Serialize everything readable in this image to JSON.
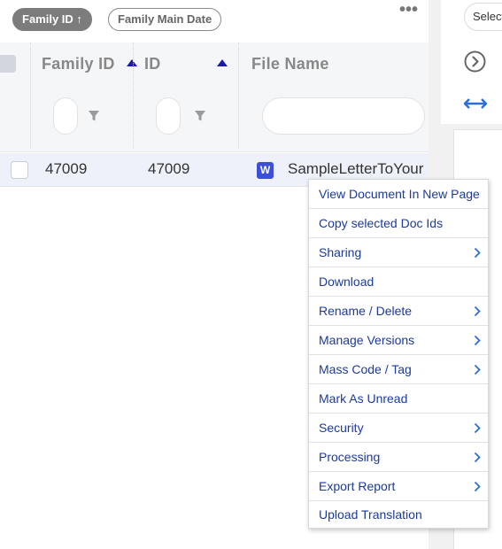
{
  "sort_chips": {
    "active_label": "Family ID",
    "active_arrow": "↑",
    "inactive_label": "Family Main Date"
  },
  "grid": {
    "more_label": "•••",
    "columns": [
      "Family ID",
      "ID",
      "File Name"
    ],
    "rows": [
      {
        "family_id": "47009",
        "id": "47009",
        "file_icon": "W",
        "file_name": "SampleLetterToYour"
      }
    ]
  },
  "right_panel": {
    "select_text": "Select"
  },
  "context_menu": {
    "items": [
      {
        "label": "View Document In New Page",
        "has_submenu": false
      },
      {
        "label": "Copy selected Doc Ids",
        "has_submenu": false
      },
      {
        "label": "Sharing",
        "has_submenu": true
      },
      {
        "label": "Download",
        "has_submenu": false
      },
      {
        "label": "Rename / Delete",
        "has_submenu": true
      },
      {
        "label": "Manage Versions",
        "has_submenu": true
      },
      {
        "label": "Mass Code / Tag",
        "has_submenu": true
      },
      {
        "label": "Mark As Unread",
        "has_submenu": false
      },
      {
        "label": "Security",
        "has_submenu": true
      },
      {
        "label": "Processing",
        "has_submenu": true
      },
      {
        "label": "Export Report",
        "has_submenu": true
      },
      {
        "label": "Upload Translation",
        "has_submenu": false
      }
    ]
  },
  "colors": {
    "menu_text": "#1c3a9c",
    "sort_indicator": "#1a1aa8",
    "word_icon": "#3b4fd8",
    "arrow_blue": "#2a6fd6"
  },
  "icons": [
    "more-horizontal-icon",
    "sort-asc-icon",
    "filter-icon",
    "word-file-icon",
    "chevron-right-circle-icon",
    "resize-horizontal-icon",
    "chevron-right-icon"
  ]
}
